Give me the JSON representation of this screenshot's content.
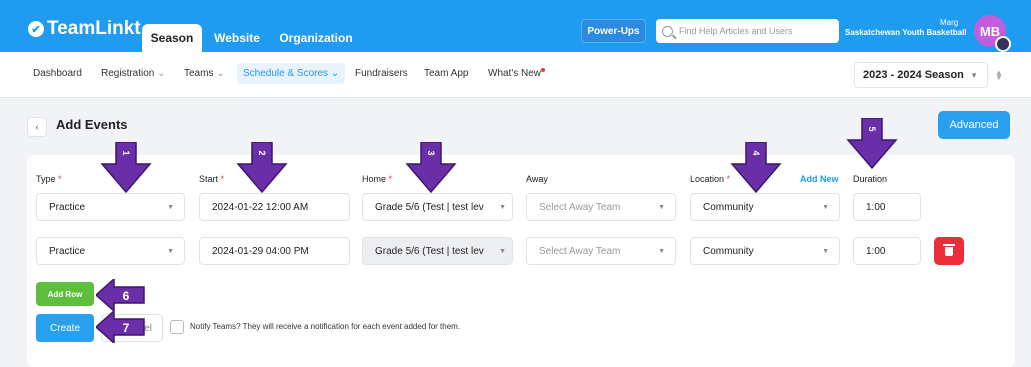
{
  "header": {
    "logo": "TeamLinkt",
    "tabs": [
      {
        "label": "Season",
        "active": true
      },
      {
        "label": "Website",
        "active": false
      },
      {
        "label": "Organization",
        "active": false
      }
    ],
    "powerups": "Power-Ups",
    "search_placeholder": "Find Help Articles and Users",
    "org_name": "Saskatchewan Youth Basketball",
    "user_name": "Marg",
    "avatar_initials": "MB"
  },
  "nav": {
    "items": [
      {
        "label": "Dashboard",
        "active": false,
        "dropdown": false
      },
      {
        "label": "Registration",
        "active": false,
        "dropdown": true
      },
      {
        "label": "Teams",
        "active": false,
        "dropdown": true
      },
      {
        "label": "Schedule & Scores",
        "active": true,
        "dropdown": true
      },
      {
        "label": "Fundraisers",
        "active": false,
        "dropdown": false
      },
      {
        "label": "Team App",
        "active": false,
        "dropdown": false
      },
      {
        "label": "What's New",
        "active": false,
        "dropdown": false,
        "badge": true
      }
    ],
    "season_select": "2023 - 2024 Season"
  },
  "page": {
    "title": "Add Events",
    "advanced_button": "Advanced"
  },
  "form": {
    "labels": {
      "type": "Type",
      "start": "Start",
      "home": "Home",
      "away": "Away",
      "location": "Location",
      "add_new": "Add New",
      "duration": "Duration",
      "required_mark": "*"
    },
    "rows": [
      {
        "type": "Practice",
        "start": "2024-01-22 12:00 AM",
        "home": "Grade 5/6 (Test | test lev",
        "away_placeholder": "Select Away Team",
        "location": "Community",
        "duration": "1:00"
      },
      {
        "type": "Practice",
        "start": "2024-01-29 04:00 PM",
        "home": "Grade 5/6 (Test | test lev",
        "away_placeholder": "Select Away Team",
        "location": "Community",
        "duration": "1:00"
      }
    ],
    "add_row_button": "Add Row",
    "create_button": "Create",
    "cancel_button_partial": "el",
    "notify_text": "Notify Teams? They will receive a notification for each event added for them."
  },
  "annotations": {
    "color": "#6a2fa8",
    "numbers": [
      "1",
      "2",
      "3",
      "4",
      "5",
      "6",
      "7"
    ]
  }
}
